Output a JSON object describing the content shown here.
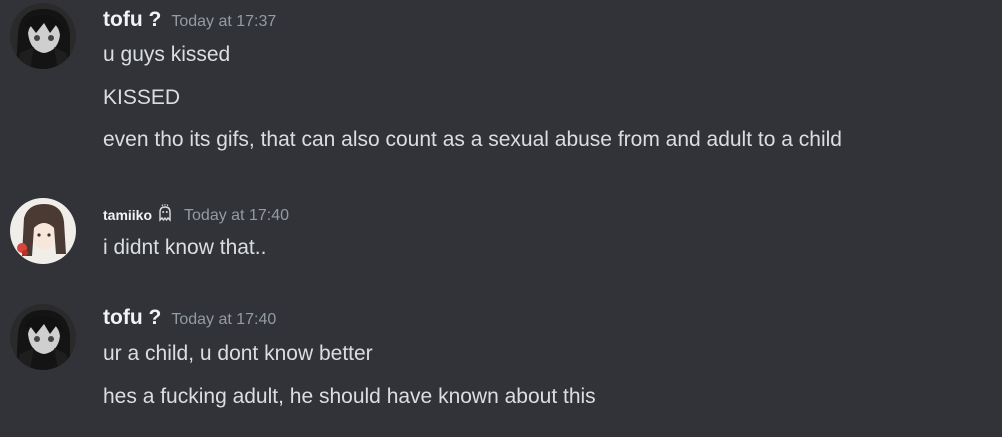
{
  "messages": [
    {
      "username": "tofu ?",
      "timestamp": "Today at 17:37",
      "lines": [
        "u guys kissed",
        "KISSED",
        "even tho its gifs, that can also count as a sexual abuse from and adult to a child"
      ]
    },
    {
      "username": "tamiiko",
      "timestamp": "Today at 17:40",
      "lines": [
        "i didnt know that.."
      ]
    },
    {
      "username": "tofu ?",
      "timestamp": "Today at 17:40",
      "lines": [
        "ur a child, u dont know better",
        "hes a fucking adult, he should have known about this"
      ]
    }
  ],
  "colors": {
    "background": "#313338",
    "username": "#f2f3f5",
    "timestamp": "#949ba4",
    "message_text": "#dbdee1"
  },
  "icons": {
    "tamiiko_badge": "ghost-badge-icon"
  }
}
